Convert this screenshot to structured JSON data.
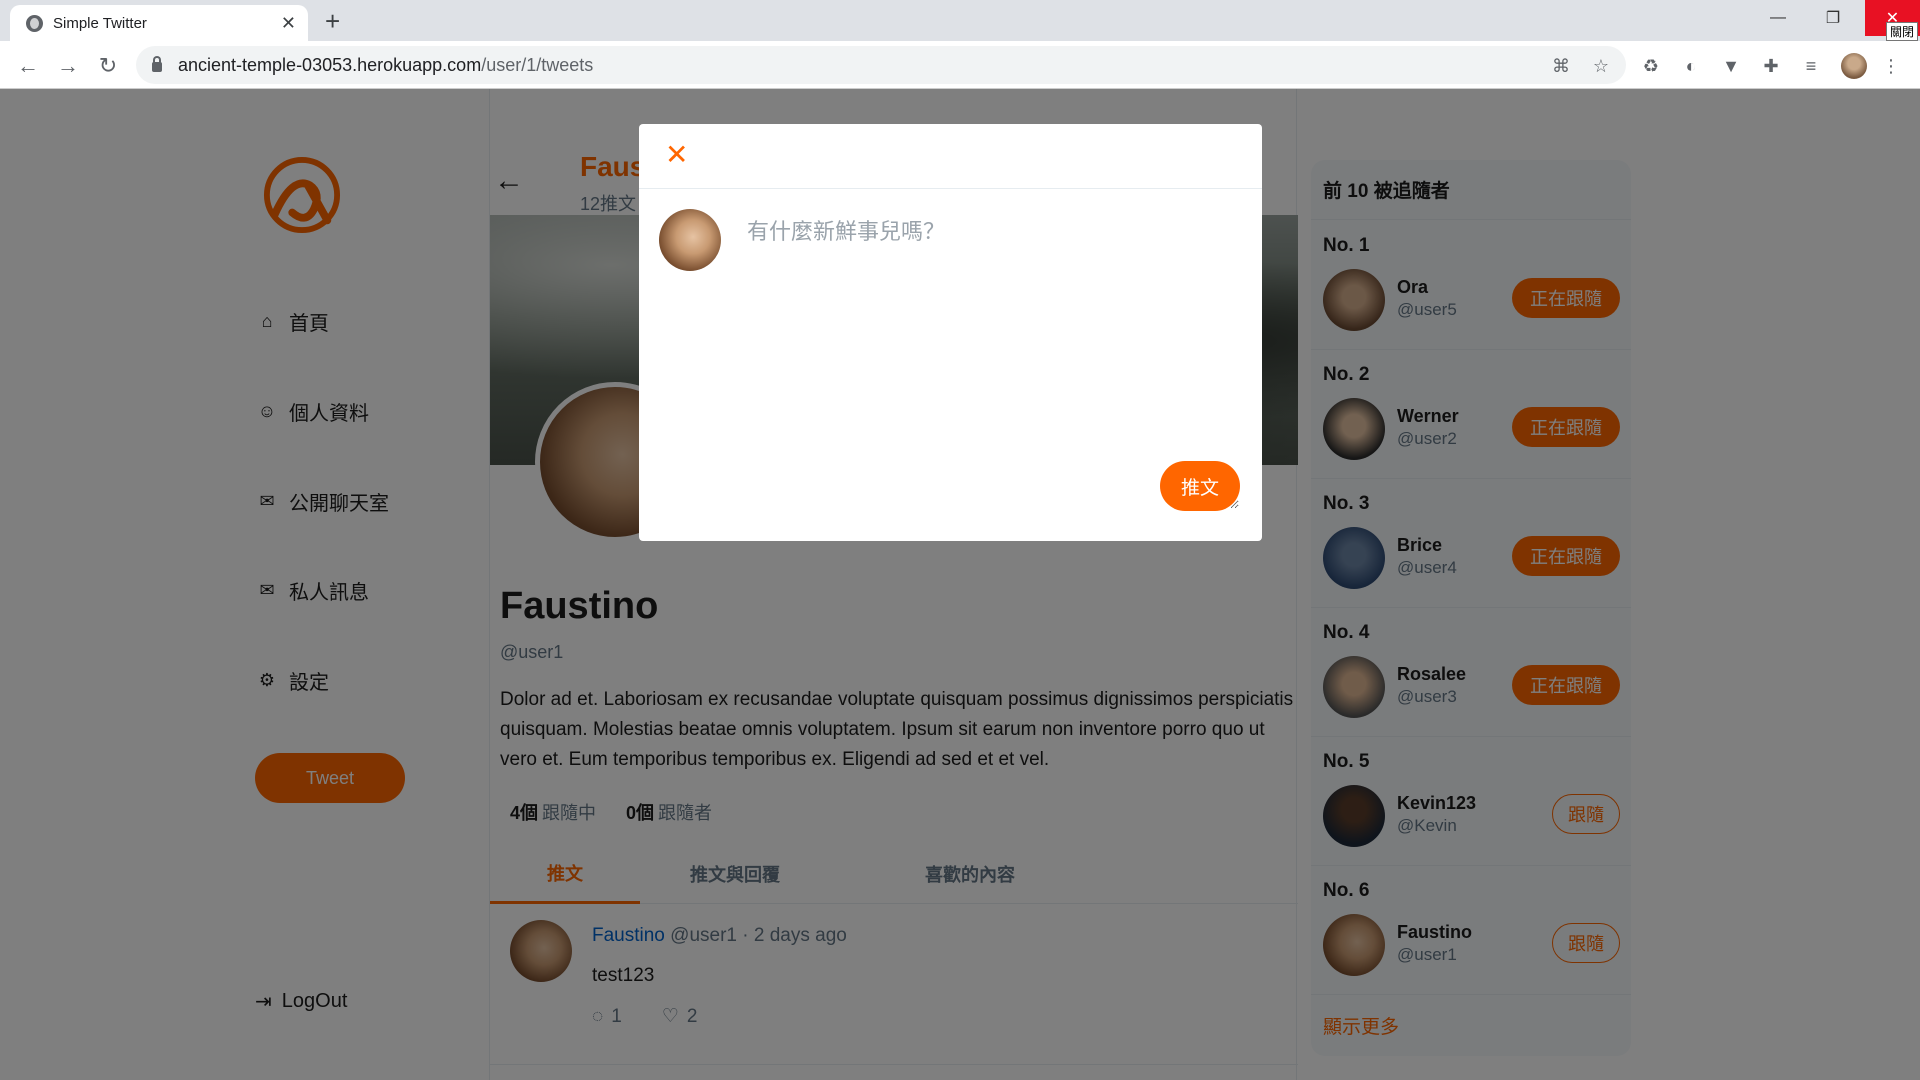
{
  "browser": {
    "tab_title": "Simple Twitter",
    "new_tab_icon": "+",
    "url_host": "ancient-temple-03053.herokuapp.com",
    "url_path": "/user/1/tweets",
    "close_tooltip": "關閉"
  },
  "sidebar": {
    "items": [
      {
        "label": "首頁",
        "icon": "home-icon"
      },
      {
        "label": "個人資料",
        "icon": "user-icon"
      },
      {
        "label": "公開聊天室",
        "icon": "chat-icon"
      },
      {
        "label": "私人訊息",
        "icon": "mail-icon"
      },
      {
        "label": "設定",
        "icon": "gear-icon"
      }
    ],
    "tweet_button": "Tweet",
    "logout": "LogOut"
  },
  "header": {
    "name": "Faustino",
    "tweet_count": "12推文"
  },
  "profile": {
    "name": "Faustino",
    "handle": "@user1",
    "bio": "Dolor ad et. Laboriosam ex recusandae voluptate quisquam possimus dignissimos perspiciatis quisquam. Molestias beatae omnis voluptatem. Ipsum sit earum non inventore porro quo ut vero et. Eum temporibus temporibus ex. Eligendi ad sed et et vel.",
    "following_count": "4個",
    "following_label": "跟隨中",
    "followers_count": "0個",
    "followers_label": "跟隨者"
  },
  "tabs": [
    {
      "label": "推文",
      "active": true
    },
    {
      "label": "推文與回覆",
      "active": false
    },
    {
      "label": "喜歡的內容",
      "active": false
    }
  ],
  "tweet": {
    "name": "Faustino",
    "handle": "@user1",
    "sep": "·",
    "time": "2 days ago",
    "text": "test123",
    "reply_count": "1",
    "like_count": "2"
  },
  "top_users": {
    "title": "前 10 被追隨者",
    "items": [
      {
        "rank": "No. 1",
        "name": "Ora",
        "handle": "@user5",
        "button": "正在跟隨",
        "following": true
      },
      {
        "rank": "No. 2",
        "name": "Werner",
        "handle": "@user2",
        "button": "正在跟隨",
        "following": true
      },
      {
        "rank": "No. 3",
        "name": "Brice",
        "handle": "@user4",
        "button": "正在跟隨",
        "following": true
      },
      {
        "rank": "No. 4",
        "name": "Rosalee",
        "handle": "@user3",
        "button": "正在跟隨",
        "following": true
      },
      {
        "rank": "No. 5",
        "name": "Kevin123",
        "handle": "@Kevin",
        "button": "跟隨",
        "following": false
      },
      {
        "rank": "No. 6",
        "name": "Faustino",
        "handle": "@user1",
        "button": "跟隨",
        "following": false
      }
    ],
    "show_more": "顯示更多"
  },
  "modal": {
    "placeholder": "有什麼新鮮事兒嗎？",
    "value": "",
    "submit": "推文"
  },
  "colors": {
    "accent": "#ff6600",
    "link": "#0062cc",
    "muted": "#657786"
  }
}
